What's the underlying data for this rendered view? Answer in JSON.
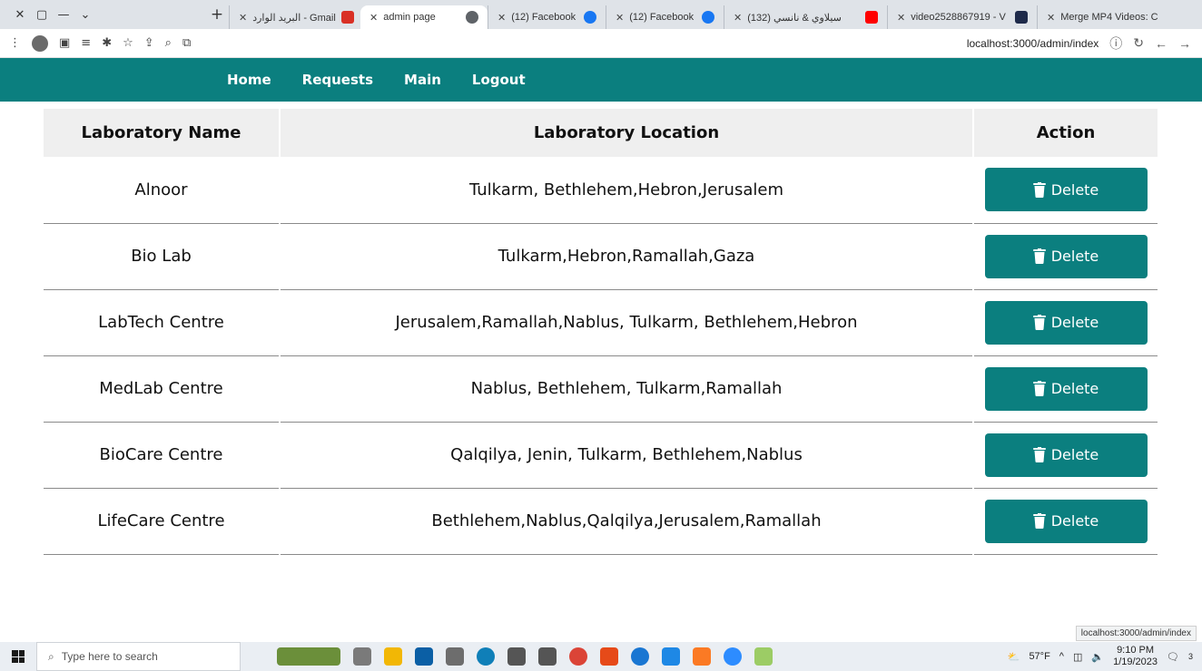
{
  "browser": {
    "tabs": [
      {
        "title": "البريد الوارد - Gmail",
        "prefix": "m - Gmail",
        "icon": "gmail-icon",
        "color": "#d93025",
        "active": false
      },
      {
        "title": "admin page",
        "icon": "globe-icon",
        "color": "#5f6368",
        "active": true
      },
      {
        "title": "(12) Facebook",
        "icon": "facebook-icon",
        "color": "#1877f2",
        "active": false
      },
      {
        "title": "(12) Facebook",
        "icon": "facebook-icon",
        "color": "#1877f2",
        "active": false
      },
      {
        "title": "(132) سيلاوي & نانسي",
        "icon": "youtube-icon",
        "color": "#ff0000",
        "active": false
      },
      {
        "title": "video2528867919 - V",
        "icon": "v-icon",
        "color": "#1e2a4a",
        "active": false
      },
      {
        "title": "Merge MP4 Videos: C",
        "icon": "app-icon",
        "color": "#1e2a4a",
        "active": false
      }
    ],
    "url": "localhost:3000/admin/index",
    "status_url": "localhost:3000/admin/index"
  },
  "navbar": {
    "links": [
      {
        "label": "Home"
      },
      {
        "label": "Requests"
      },
      {
        "label": "Main"
      },
      {
        "label": "Logout"
      }
    ]
  },
  "table": {
    "headers": {
      "name": "Laboratory Name",
      "location": "Laboratory Location",
      "action": "Action"
    },
    "rows": [
      {
        "name": "Alnoor",
        "location": "Tulkarm, Bethlehem,Hebron,Jerusalem",
        "action": "Delete"
      },
      {
        "name": "Bio Lab",
        "location": "Tulkarm,Hebron,Ramallah,Gaza",
        "action": "Delete"
      },
      {
        "name": "LabTech Centre",
        "location": "Jerusalem,Ramallah,Nablus, Tulkarm, Bethlehem,Hebron",
        "action": "Delete"
      },
      {
        "name": "MedLab Centre",
        "location": "Nablus, Bethlehem, Tulkarm,Ramallah",
        "action": "Delete"
      },
      {
        "name": "BioCare Centre",
        "location": "Qalqilya, Jenin, Tulkarm, Bethlehem,Nablus",
        "action": "Delete"
      },
      {
        "name": "LifeCare Centre",
        "location": "Bethlehem,Nablus,Qalqilya,Jerusalem,Ramallah",
        "action": "Delete"
      }
    ]
  },
  "taskbar": {
    "search_placeholder": "Type here to search",
    "weather": "57°F",
    "time": "9:10 PM",
    "date": "1/19/2023",
    "notifications": "3"
  },
  "colors": {
    "primary": "#0b7f7f",
    "header_bg": "#efefef"
  }
}
